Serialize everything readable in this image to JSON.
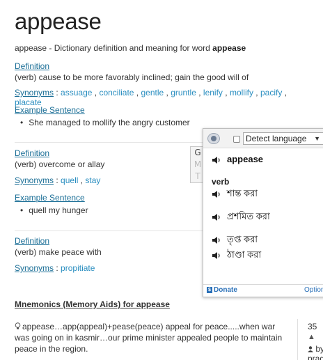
{
  "page": {
    "title": "appease",
    "intro_prefix": "appease - Dictionary definition and meaning for word ",
    "intro_word": "appease"
  },
  "senses": [
    {
      "definition_label": "Definition",
      "definition": "(verb) cause to be more favorably inclined; gain the good will of",
      "synonyms_label": "Synonyms",
      "synonyms": [
        "assuage",
        "conciliate",
        "gentle",
        "gruntle",
        "lenify",
        "mollify",
        "pacify",
        "placate"
      ],
      "example_label": "Example Sentence",
      "example": "She managed to mollify the angry customer"
    },
    {
      "definition_label": "Definition",
      "definition": "(verb) overcome or allay",
      "synonyms_label": "Synonyms",
      "synonyms": [
        "quell",
        "stay"
      ],
      "example_label": "Example Sentence",
      "example": "quell my hunger"
    },
    {
      "definition_label": "Definition",
      "definition": "(verb) make peace with",
      "synonyms_label": "Synonyms",
      "synonyms": [
        "propitiate"
      ]
    }
  ],
  "mnemonics": {
    "title": "Mnemonics (Memory Aids) for appease",
    "text": "appease…app(appeal)+pease(peace) appeal for peace.....when war was going on in kasmir…our prime minister appealed people to maintain peace in the region.",
    "count": "35",
    "by": "by",
    "by_trailing": "prag"
  },
  "translate_popup": {
    "tab_letters": [
      "G",
      "M",
      "T"
    ],
    "detect_language": "Detect language",
    "word": "appease",
    "part_of_speech": "verb",
    "translations": [
      "শান্ত করা",
      "প্রশমিত করা",
      "তৃপ্ত করা",
      "ঠাণ্ডা করা"
    ],
    "donate": "Donate",
    "options": "Options"
  },
  "colors": {
    "link": "#2a8ec0",
    "label": "#1a6e96"
  }
}
